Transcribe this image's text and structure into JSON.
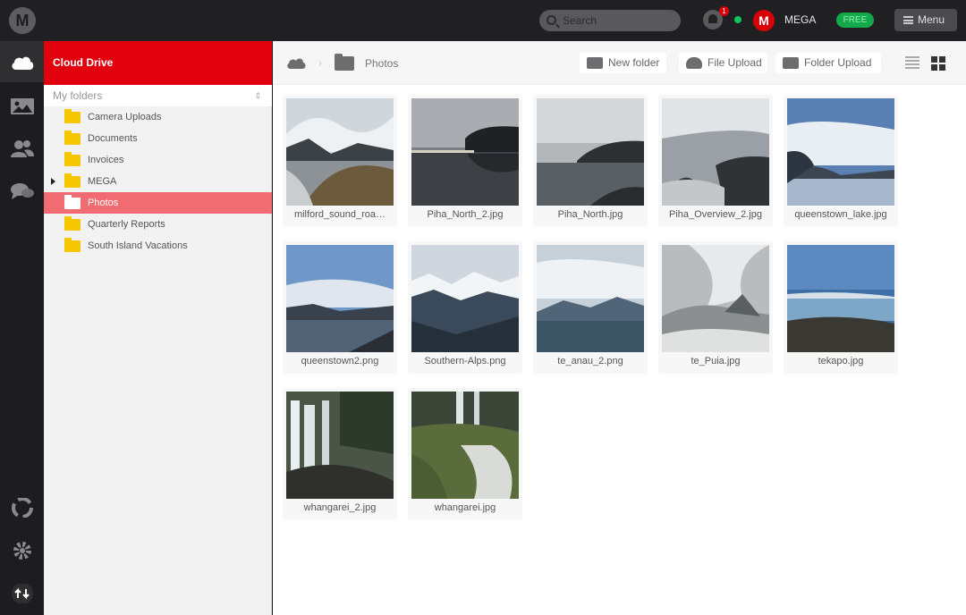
{
  "topbar": {
    "search_placeholder": "Search",
    "notification_count": "1",
    "user_initial": "M",
    "user_name": "MEGA",
    "plan": "FREE",
    "menu_label": "Menu"
  },
  "sidebar": {
    "header": "Cloud Drive",
    "subheader": "My folders",
    "sort_glyph": "⇕",
    "folders": [
      {
        "label": "Camera Uploads"
      },
      {
        "label": "Documents"
      },
      {
        "label": "Invoices"
      },
      {
        "label": "MEGA"
      },
      {
        "label": "Photos"
      },
      {
        "label": "Quarterly Reports"
      },
      {
        "label": "South Island Vacations"
      }
    ],
    "selected_folder": "Photos"
  },
  "toolbar": {
    "breadcrumb_current": "Photos",
    "breadcrumb_separator": "›",
    "new_folder": "New folder",
    "file_upload": "File Upload",
    "folder_upload": "Folder Upload"
  },
  "files": [
    {
      "name": "milford_sound_roa…"
    },
    {
      "name": "Piha_North_2.jpg"
    },
    {
      "name": "Piha_North.jpg"
    },
    {
      "name": "Piha_Overview_2.jpg"
    },
    {
      "name": "queenstown_lake.jpg"
    },
    {
      "name": "queenstown2.png"
    },
    {
      "name": "Southern-Alps.png"
    },
    {
      "name": "te_anau_2.png"
    },
    {
      "name": "te_Puia.jpg"
    },
    {
      "name": "tekapo.jpg"
    },
    {
      "name": "whangarei_2.jpg"
    },
    {
      "name": "whangarei.jpg"
    }
  ],
  "colors": {
    "accent": "#e0000e",
    "selected_row": "#f06c72",
    "folder_yellow": "#f6c600",
    "online_green": "#13c45b"
  }
}
